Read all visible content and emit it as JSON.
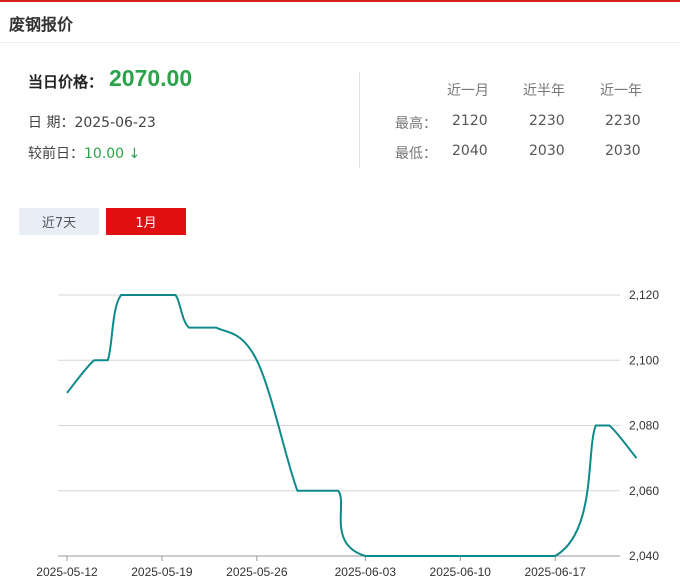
{
  "header": {
    "title": "废钢报价"
  },
  "summary": {
    "price_label": "当日价格：",
    "price_value": "2070.00",
    "date_label": "日 期：",
    "date_value": "2025-06-23",
    "prev_label": "较前日：",
    "prev_value": "10.00 ↓"
  },
  "stats": {
    "columns": [
      "近一月",
      "近半年",
      "近一年"
    ],
    "rows": [
      {
        "label": "最高：",
        "values": [
          "2120",
          "2230",
          "2230"
        ]
      },
      {
        "label": "最低：",
        "values": [
          "2040",
          "2030",
          "2030"
        ]
      }
    ]
  },
  "tabs": [
    {
      "label": "近7天",
      "active": false
    },
    {
      "label": "1月",
      "active": true
    }
  ],
  "colors": {
    "accent": "#e01010",
    "up_green": "#2aa34a",
    "line": "#0f8a8a",
    "tab_inactive": "#e8eef7"
  },
  "chart_data": {
    "type": "line",
    "title": "",
    "xlabel": "",
    "ylabel": "",
    "x_ticks": [
      "2025-05-12",
      "2025-05-19",
      "2025-05-26",
      "2025-06-03",
      "2025-06-10",
      "2025-06-17"
    ],
    "y_ticks": [
      "2,040",
      "2,060",
      "2,080",
      "2,100",
      "2,120"
    ],
    "ylim": [
      2040,
      2120
    ],
    "grid": true,
    "series": [
      {
        "values": [
          [
            "2025-05-12",
            2090
          ],
          [
            "2025-05-14",
            2100
          ],
          [
            "2025-05-15",
            2100
          ],
          [
            "2025-05-16",
            2120
          ],
          [
            "2025-05-19",
            2120
          ],
          [
            "2025-05-20",
            2120
          ],
          [
            "2025-05-21",
            2110
          ],
          [
            "2025-05-23",
            2110
          ],
          [
            "2025-05-26",
            2100
          ],
          [
            "2025-05-29",
            2060
          ],
          [
            "2025-05-30",
            2060
          ],
          [
            "2025-06-01",
            2060
          ],
          [
            "2025-06-03",
            2040
          ],
          [
            "2025-06-17",
            2040
          ],
          [
            "2025-06-20",
            2080
          ],
          [
            "2025-06-21",
            2080
          ],
          [
            "2025-06-23",
            2070
          ]
        ]
      }
    ]
  }
}
